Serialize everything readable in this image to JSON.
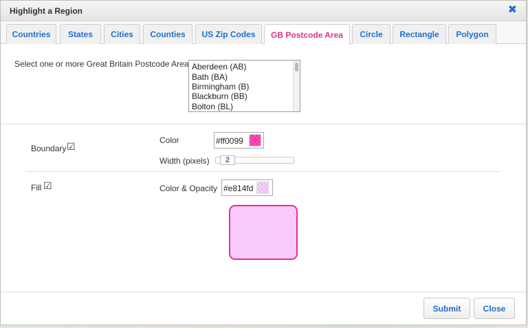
{
  "dialog": {
    "title": "Highlight a Region",
    "close_glyph": "✖"
  },
  "tabs": [
    {
      "label": "Countries",
      "active": false
    },
    {
      "label": "States",
      "active": false
    },
    {
      "label": "Cities",
      "active": false
    },
    {
      "label": "Counties",
      "active": false
    },
    {
      "label": "US Zip Codes",
      "active": false
    },
    {
      "label": "GB Postcode Area",
      "active": true
    },
    {
      "label": "Circle",
      "active": false
    },
    {
      "label": "Rectangle",
      "active": false
    },
    {
      "label": "Polygon",
      "active": false
    }
  ],
  "postcode": {
    "prompt": "Select one or more Great Britain Postcode Areas",
    "options": [
      "Aberdeen (AB)",
      "Bath (BA)",
      "Birmingham (B)",
      "Blackburn (BB)",
      "Bolton (BL)"
    ]
  },
  "boundary": {
    "label": "Boundary",
    "checked": true,
    "color_label": "Color",
    "color_value": "#ff0099",
    "width_label": "Width (pixels)",
    "width_value": "2"
  },
  "fill": {
    "label": "Fill",
    "checked": true,
    "color_label": "Color & Opacity",
    "color_value": "#e814fd"
  },
  "icons": {
    "checkmark": "☑"
  },
  "buttons": {
    "submit": "Submit",
    "close": "Close"
  },
  "colors": {
    "accent_active_tab": "#e0338a",
    "link_blue": "#1f6fd1",
    "boundary_swatch": "#ff3aa8",
    "fill_preview": "#f9c8fc"
  }
}
